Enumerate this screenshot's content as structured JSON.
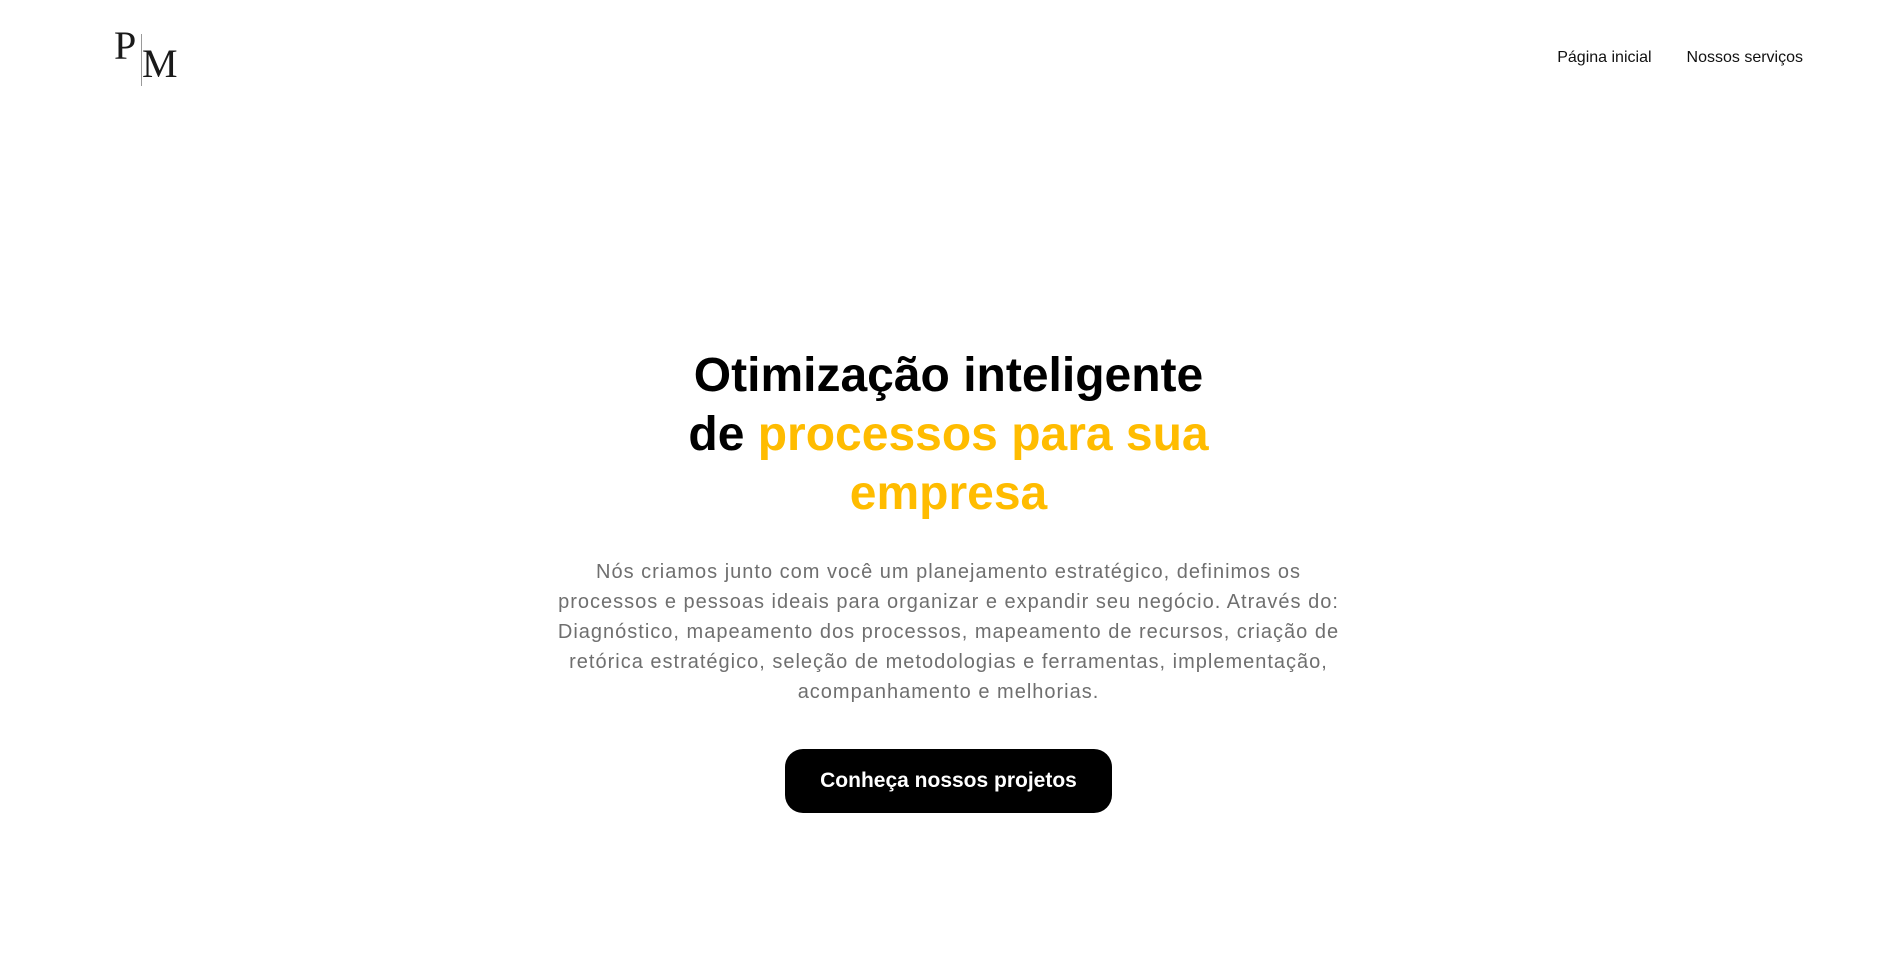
{
  "brand": {
    "logo_text": "PM"
  },
  "nav": {
    "items": [
      {
        "label": "Página inicial"
      },
      {
        "label": "Nossos serviços"
      }
    ]
  },
  "hero": {
    "title_line1": "Otimização inteligente",
    "title_line2_prefix": "de ",
    "title_highlight": "processos para sua empresa",
    "description": "Nós criamos junto com você um planejamento estratégico, definimos os processos e pessoas ideais para organizar e expandir seu negócio. Através do: Diagnóstico, mapeamento dos processos, mapeamento de recursos, criação de retórica estratégico, seleção de metodologias e ferramentas, implementação, acompanhamento e melhorias.",
    "cta_label": "Conheça nossos projetos"
  },
  "colors": {
    "accent": "#ffbc00",
    "text": "#000000",
    "muted": "#6f6f6f",
    "button_bg": "#000000",
    "button_text": "#ffffff"
  }
}
